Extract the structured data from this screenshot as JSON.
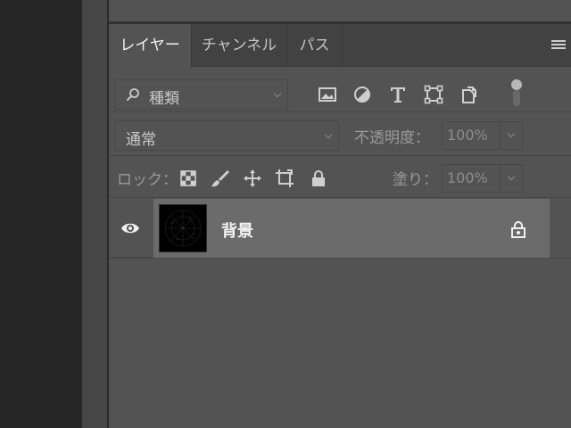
{
  "tabs": [
    {
      "label": "レイヤー",
      "active": true
    },
    {
      "label": "チャンネル",
      "active": false
    },
    {
      "label": "パス",
      "active": false
    }
  ],
  "filter": {
    "kind_label": "種類",
    "icons": [
      "image-filter-icon",
      "adjustment-filter-icon",
      "type-filter-icon",
      "shape-filter-icon",
      "smart-object-filter-icon"
    ]
  },
  "blend": {
    "mode": "通常",
    "opacity_label": "不透明度：",
    "opacity_value": "100%"
  },
  "lock": {
    "label": "ロック：",
    "icons": [
      "lock-transparent-pixels-icon",
      "lock-image-pixels-icon",
      "lock-position-icon",
      "lock-artboard-icon",
      "lock-all-icon"
    ],
    "fill_label": "塗り：",
    "fill_value": "100%"
  },
  "layers": [
    {
      "name": "背景",
      "visible": true,
      "locked": true
    }
  ],
  "colors": {
    "panel_bg": "#535353",
    "tab_bar_bg": "#424242",
    "selected_layer_bg": "#6b6b6b",
    "app_dark_bg": "#262626"
  }
}
